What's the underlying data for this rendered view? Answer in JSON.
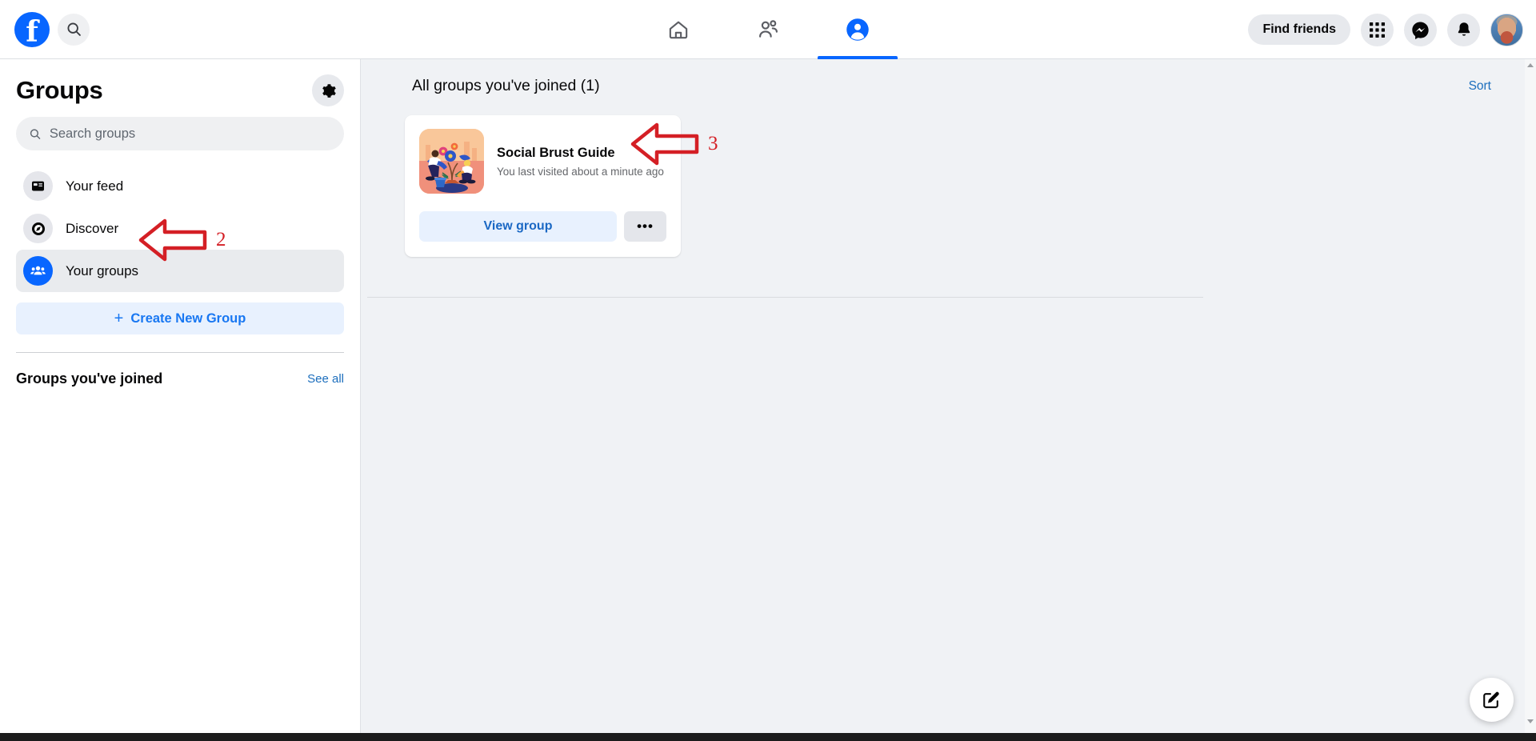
{
  "header": {
    "logo_icon": "facebook-logo",
    "search_icon": "search-icon",
    "tabs": [
      {
        "icon": "home-icon",
        "name": "home",
        "active": false
      },
      {
        "icon": "friends-icon",
        "name": "friends",
        "active": false
      },
      {
        "icon": "groups-icon",
        "name": "groups",
        "active": true
      }
    ],
    "find_friends_label": "Find friends",
    "menu_icon": "grid-menu-icon",
    "messenger_icon": "messenger-icon",
    "notifications_icon": "bell-icon",
    "avatar_icon": "profile-avatar"
  },
  "sidebar": {
    "title": "Groups",
    "settings_icon": "gear-icon",
    "search_placeholder": "Search groups",
    "search_value": "",
    "items": [
      {
        "label": "Your feed",
        "icon": "feed-icon",
        "active": false
      },
      {
        "label": "Discover",
        "icon": "compass-icon",
        "active": false
      },
      {
        "label": "Your groups",
        "icon": "people-group-icon",
        "active": true
      }
    ],
    "create_group_label": "Create New Group",
    "create_group_icon": "plus-icon",
    "joined_section_title": "Groups you've joined",
    "see_all_label": "See all"
  },
  "main": {
    "title": "All groups you've joined (1)",
    "sort_label": "Sort",
    "groups": [
      {
        "name": "Social Brust Guide",
        "subtitle": "You last visited about a minute ago",
        "thumbnail_icon": "gardening-illustration",
        "view_label": "View group",
        "more_label": "•••"
      }
    ]
  },
  "annotations": [
    {
      "id": "2",
      "label": "2",
      "icon": "red-left-arrow",
      "target": "sidebar-item-your-groups"
    },
    {
      "id": "3",
      "label": "3",
      "icon": "red-left-arrow",
      "target": "group-card"
    }
  ],
  "fab": {
    "icon": "compose-icon"
  },
  "colors": {
    "brand_blue": "#0866ff",
    "link_blue": "#1b68c4",
    "annotation_red": "#d41f25",
    "page_bg": "#f0f2f5",
    "surface": "#ffffff"
  }
}
